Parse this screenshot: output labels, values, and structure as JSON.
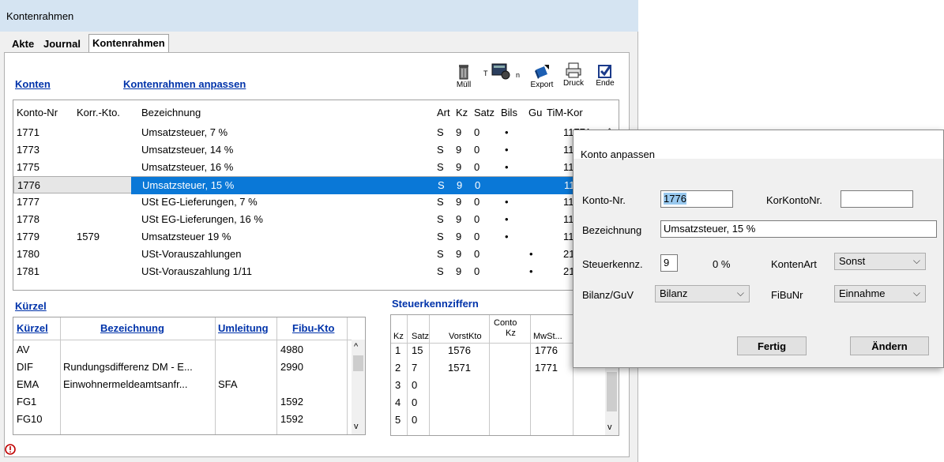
{
  "window": {
    "title": "Kontenrahmen"
  },
  "tabs": [
    {
      "label": "Akte"
    },
    {
      "label": "Journal"
    },
    {
      "label": "Kontenrahmen"
    }
  ],
  "links": {
    "konten": "Konten",
    "kontenrahmen_anpassen": "Kontenrahmen anpassen",
    "kuerzel": "Kürzel",
    "steuerkennziffern": "Steuerkennziffern"
  },
  "toolbar": {
    "muell": "Müll",
    "tb": "T",
    "tb2": "n",
    "export": "Export",
    "druck": "Druck",
    "ende": "Ende"
  },
  "konten_table": {
    "headers": [
      "Konto-Nr",
      "Korr.-Kto.",
      "Bezeichnung",
      "Art",
      "Kz",
      "Satz",
      "Bils",
      "Gu",
      "TiM-Kor"
    ],
    "rows": [
      [
        "1771",
        "",
        "Umsatzsteuer, 7 %",
        "S",
        "9",
        "0",
        "•",
        "",
        "11771"
      ],
      [
        "1773",
        "",
        "Umsatzsteuer, 14 %",
        "S",
        "9",
        "0",
        "•",
        "",
        "11"
      ],
      [
        "1775",
        "",
        "Umsatzsteuer, 16 %",
        "S",
        "9",
        "0",
        "•",
        "",
        "11"
      ],
      [
        "1776",
        "",
        "Umsatzsteuer, 15 %",
        "S",
        "9",
        "0",
        "",
        "",
        "11"
      ],
      [
        "1777",
        "",
        "USt EG-Lieferungen, 7 %",
        "S",
        "9",
        "0",
        "•",
        "",
        "11"
      ],
      [
        "1778",
        "",
        "USt EG-Lieferungen, 16 %",
        "S",
        "9",
        "0",
        "•",
        "",
        "11"
      ],
      [
        "1779",
        "1579",
        "Umsatzsteuer 19 %",
        "S",
        "9",
        "0",
        "•",
        "",
        "11"
      ],
      [
        "1780",
        "",
        "USt-Vorauszahlungen",
        "S",
        "9",
        "0",
        "",
        "•",
        "21"
      ],
      [
        "1781",
        "",
        "USt-Vorauszahlung 1/11",
        "S",
        "9",
        "0",
        "",
        "•",
        "21"
      ]
    ],
    "selected_row": 3
  },
  "kuerzel_table": {
    "headers": [
      "Kürzel",
      "Bezeichnung",
      "Umleitung",
      "Fibu-Kto"
    ],
    "rows": [
      [
        "AV",
        "",
        "",
        "4980"
      ],
      [
        "DIF",
        "Rundungsdifferenz DM - E...",
        "",
        "2990"
      ],
      [
        "EMA",
        "Einwohnermeldeamtsanfr...",
        "SFA",
        ""
      ],
      [
        "FG1",
        "",
        "",
        "1592"
      ],
      [
        "FG10",
        "",
        "",
        "1592"
      ]
    ]
  },
  "steuer_table": {
    "headers": [
      "Kz",
      "Satz",
      "VorstKto",
      "Conto",
      "Kz",
      "MwSt..."
    ],
    "rows": [
      [
        "1",
        "15",
        "1576",
        "",
        "1776"
      ],
      [
        "2",
        "7",
        "1571",
        "",
        "1771"
      ],
      [
        "3",
        "0",
        "",
        "",
        ""
      ],
      [
        "4",
        "0",
        "",
        "",
        ""
      ],
      [
        "5",
        "0",
        "",
        "",
        ""
      ]
    ]
  },
  "dialog": {
    "title": "Konto anpassen",
    "konto_nr_label": "Konto-Nr.",
    "konto_nr_value": "1776",
    "korkonto_label": "KorKontoNr.",
    "korkonto_value": "",
    "bezeichnung_label": "Bezeichnung",
    "bezeichnung_value": "Umsatzsteuer, 15 %",
    "steuerkennz_label": "Steuerkennz.",
    "steuerkennz_value": "9",
    "steuer_percent": "0 %",
    "kontenart_label": "KontenArt",
    "kontenart_value": "Sonst",
    "bilanz_label": "Bilanz/GuV",
    "bilanz_value": "Bilanz",
    "fibunr_label": "FiBuNr",
    "fibunr_value": "Einnahme",
    "fertig": "Fertig",
    "aendern": "Ändern"
  },
  "colors": {
    "selection": "#0a78d7",
    "link": "#0033aa",
    "titlebar": "#d5e4f2"
  }
}
